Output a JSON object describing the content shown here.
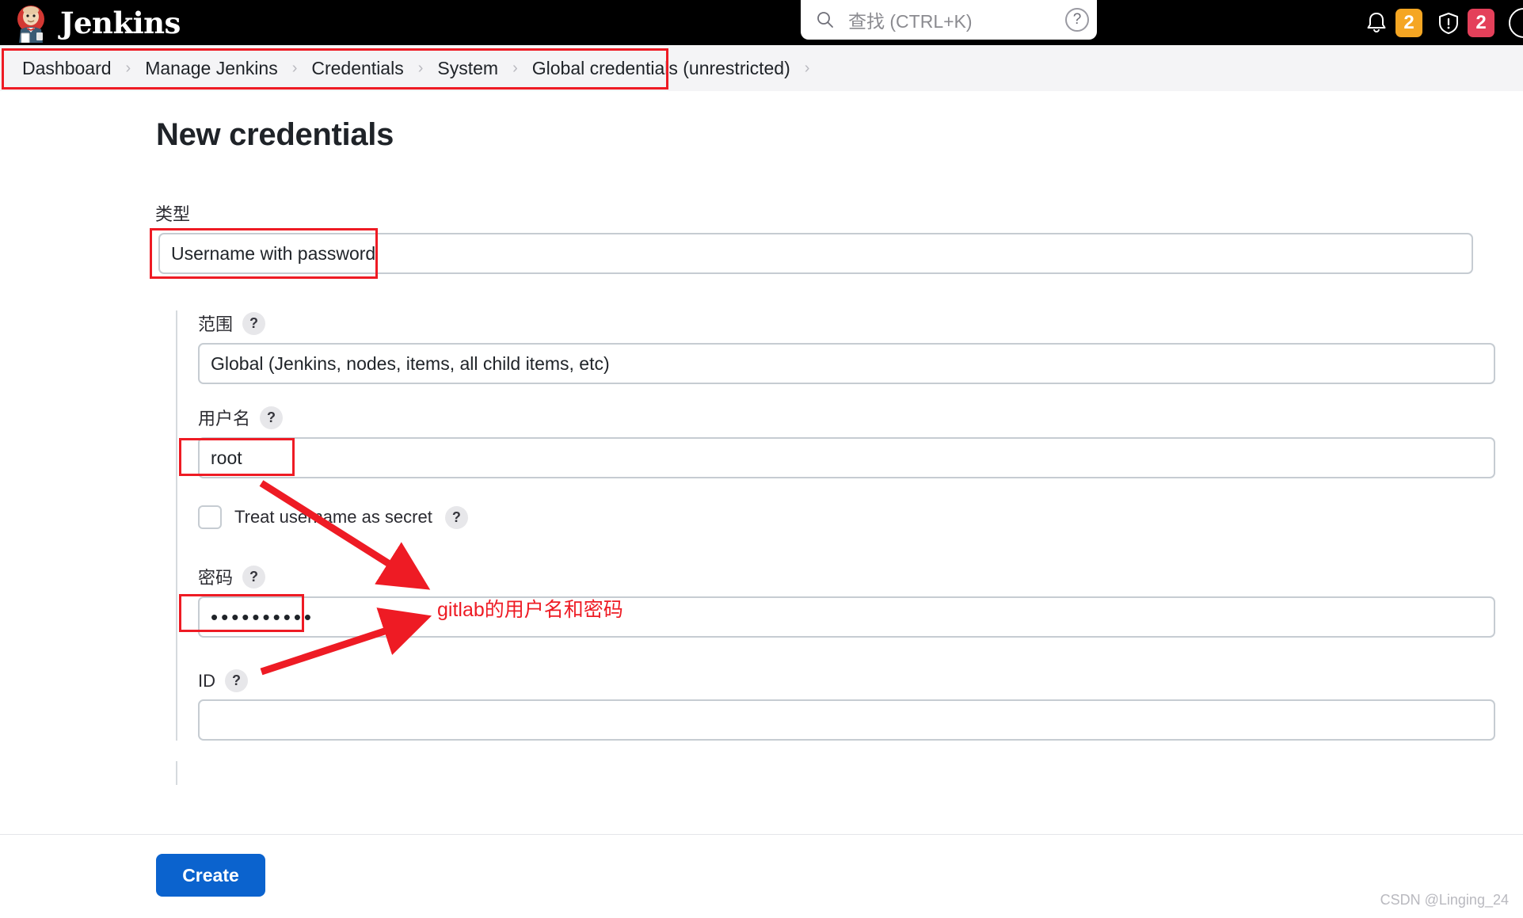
{
  "header": {
    "brand": "Jenkins",
    "logo_icon": "jenkins-butler-logo",
    "search": {
      "icon": "search-icon",
      "placeholder": "查找 (CTRL+K)",
      "help_icon": "question-mark-icon",
      "help_label": "?"
    },
    "notifications": {
      "icon": "bell-icon",
      "count": "2",
      "color": "#f5a623"
    },
    "security": {
      "icon": "shield-exclamation-icon",
      "count": "2",
      "color": "#e4405a"
    },
    "avatar_icon": "user-avatar-icon"
  },
  "breadcrumb": {
    "separator": "›",
    "items": [
      {
        "label": "Dashboard"
      },
      {
        "label": "Manage Jenkins"
      },
      {
        "label": "Credentials"
      },
      {
        "label": "System"
      },
      {
        "label": "Global credentials (unrestricted)"
      }
    ]
  },
  "page": {
    "title": "New credentials"
  },
  "form": {
    "type": {
      "label": "类型",
      "value": "Username with password",
      "icon": "chevron-down-icon"
    },
    "scope": {
      "label": "范围",
      "help": "?",
      "value": "Global (Jenkins, nodes, items, all child items, etc)"
    },
    "username": {
      "label": "用户名",
      "help": "?",
      "value": "root"
    },
    "treat_secret": {
      "label": "Treat username as secret",
      "help": "?",
      "checked": false
    },
    "password": {
      "label": "密码",
      "help": "?",
      "value": "••••••••••"
    },
    "id": {
      "label": "ID",
      "help": "?",
      "value": ""
    }
  },
  "annotations": {
    "note": "gitlab的用户名和密码",
    "color": "#ee1b24"
  },
  "footer": {
    "create_label": "Create",
    "watermark": "CSDN @Linging_24"
  }
}
